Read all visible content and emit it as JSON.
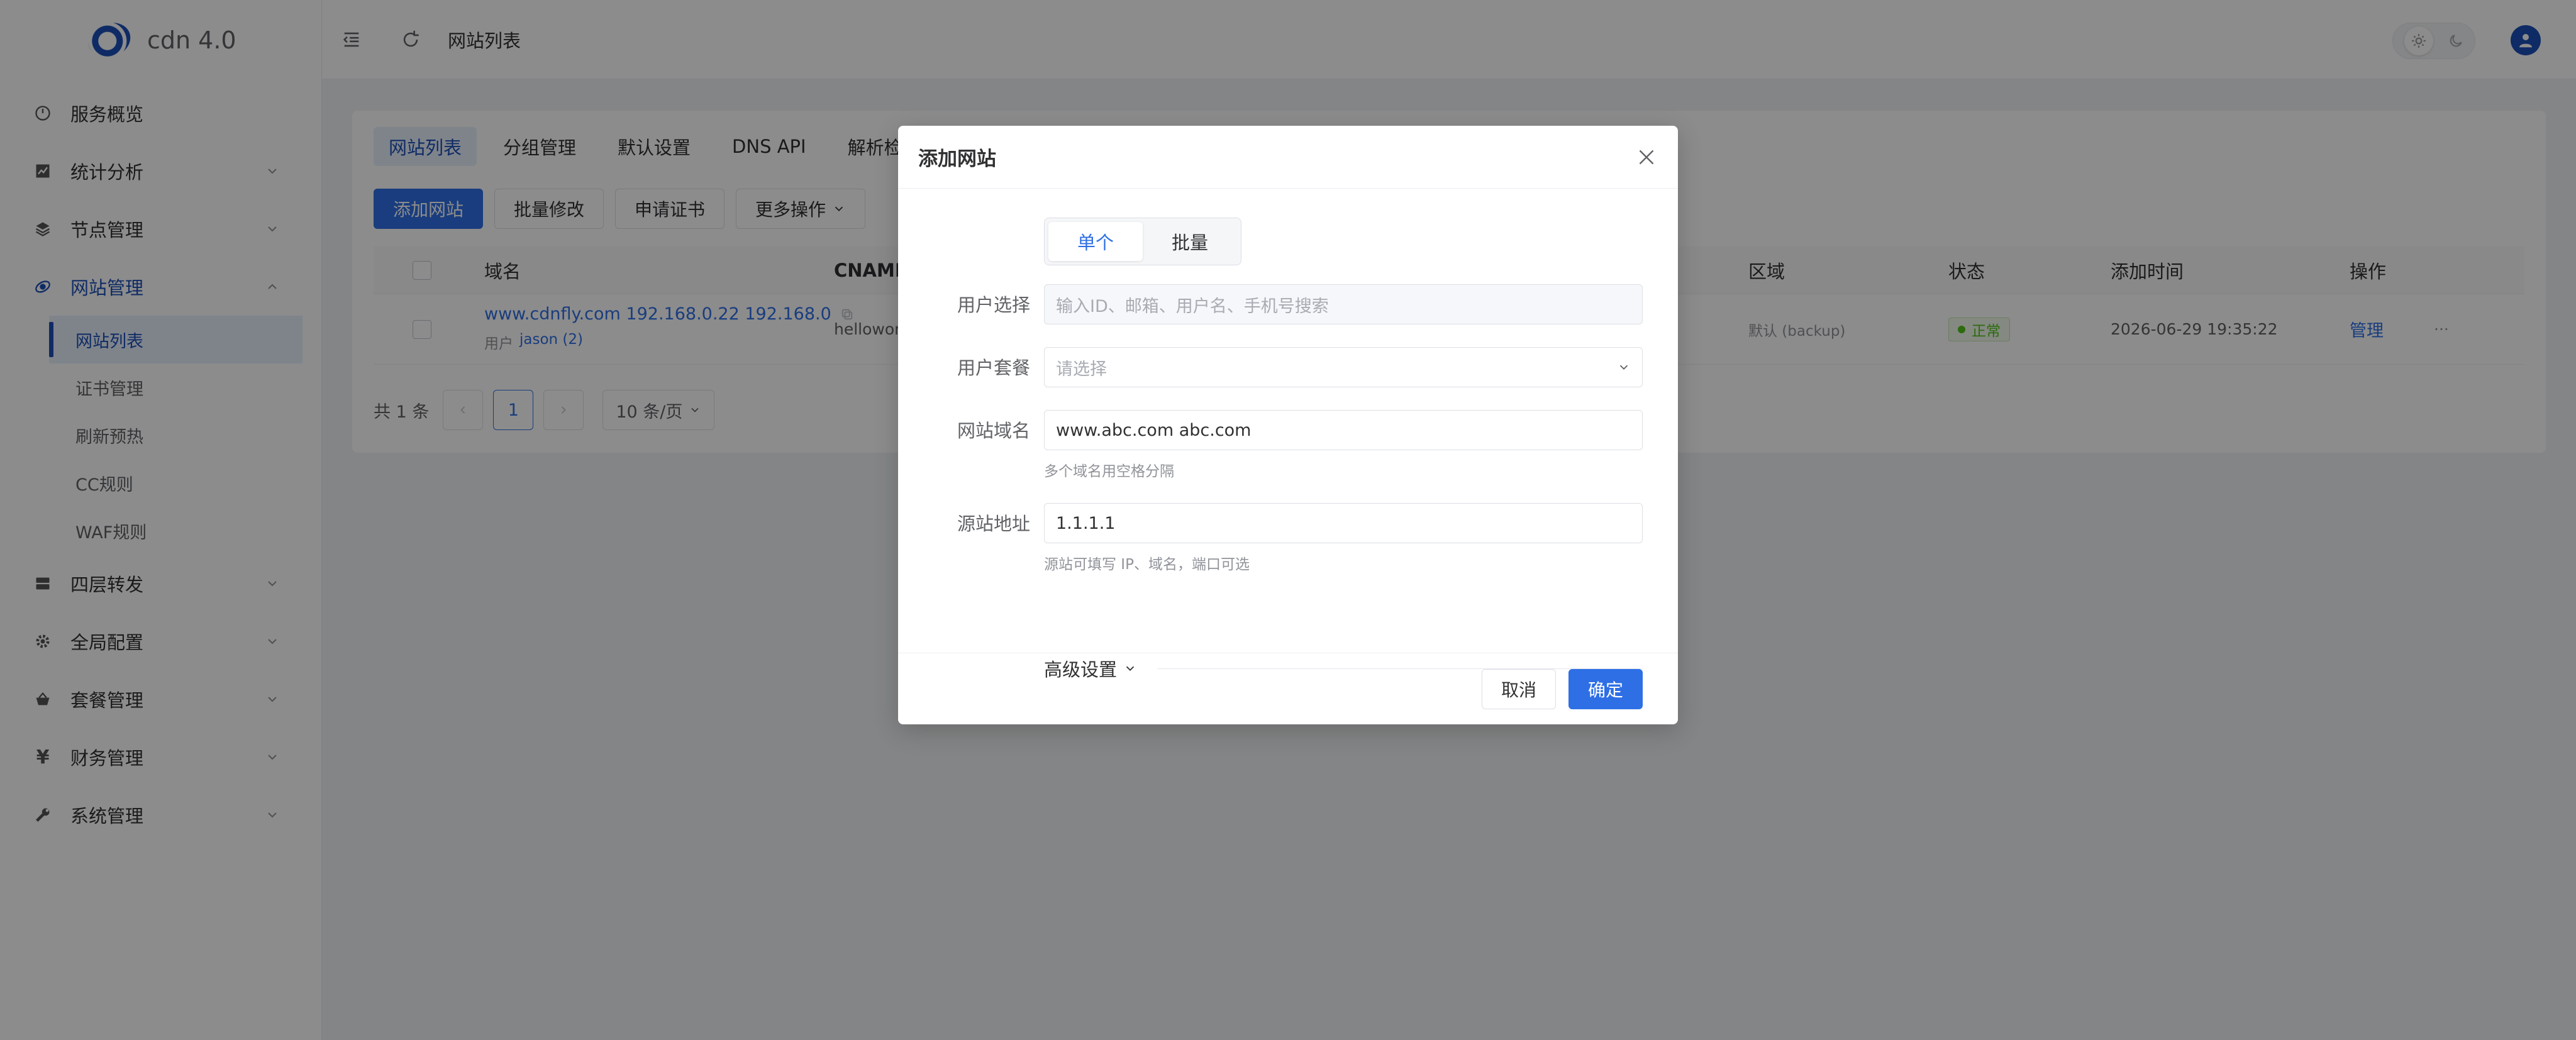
{
  "brand": {
    "name": "cdn 4.0"
  },
  "topbar": {
    "page_title": "网站列表"
  },
  "sidebar": {
    "items": [
      {
        "label": "服务概览",
        "icon": "gauge-icon",
        "has_children": false
      },
      {
        "label": "统计分析",
        "icon": "chart-icon",
        "has_children": true
      },
      {
        "label": "节点管理",
        "icon": "layers-icon",
        "has_children": true
      },
      {
        "label": "网站管理",
        "icon": "globe-icon",
        "has_children": true,
        "open": true,
        "children": [
          "网站列表",
          "证书管理",
          "刷新预热",
          "CC规则",
          "WAF规则"
        ],
        "active_child": 0
      },
      {
        "label": "四层转发",
        "icon": "server-icon",
        "has_children": true
      },
      {
        "label": "全局配置",
        "icon": "gear-icon",
        "has_children": true
      },
      {
        "label": "套餐管理",
        "icon": "basket-icon",
        "has_children": true
      },
      {
        "label": "财务管理",
        "icon": "yen-icon",
        "has_children": true
      },
      {
        "label": "系统管理",
        "icon": "wrench-icon",
        "has_children": true
      }
    ]
  },
  "main": {
    "tabs": [
      "网站列表",
      "分组管理",
      "默认设置",
      "DNS API",
      "解析检测"
    ],
    "toolbar": {
      "add": "添加网站",
      "bulk_edit": "批量修改",
      "apply_cert": "申请证书",
      "more": "更多操作"
    },
    "table": {
      "headers": {
        "domain": "域名",
        "cname": "CNAME",
        "region": "区域",
        "status": "状态",
        "added": "添加时间",
        "action": "操作"
      },
      "rows": [
        {
          "domain": "www.cdnfly.com 192.168.0.22 192.168.0",
          "user_prefix": "用户",
          "user": "jason (2)",
          "cname": "hellowor",
          "region": "默认 (backup)",
          "status": "正常",
          "added": "2026-06-29 19:35:22",
          "manage": "管理",
          "more": "···"
        }
      ]
    },
    "pagination": {
      "total": "共 1 条",
      "current_page": "1",
      "page_size": "10 条/页"
    }
  },
  "modal": {
    "title": "添加网站",
    "mode_single": "单个",
    "mode_batch": "批量",
    "user_label": "用户选择",
    "user_placeholder": "输入ID、邮箱、用户名、手机号搜索",
    "plan_label": "用户套餐",
    "plan_placeholder": "请选择",
    "domain_label": "网站域名",
    "domain_value": "www.abc.com abc.com",
    "domain_hint": "多个域名用空格分隔",
    "origin_label": "源站地址",
    "origin_value": "1.1.1.1",
    "origin_hint": "源站可填写 IP、域名，端口可选",
    "advanced": "高级设置",
    "cancel": "取消",
    "confirm": "确定"
  },
  "colors": {
    "accent": "#2e6fe6",
    "brand": "#1d4fb8",
    "success": "#52c41a"
  }
}
